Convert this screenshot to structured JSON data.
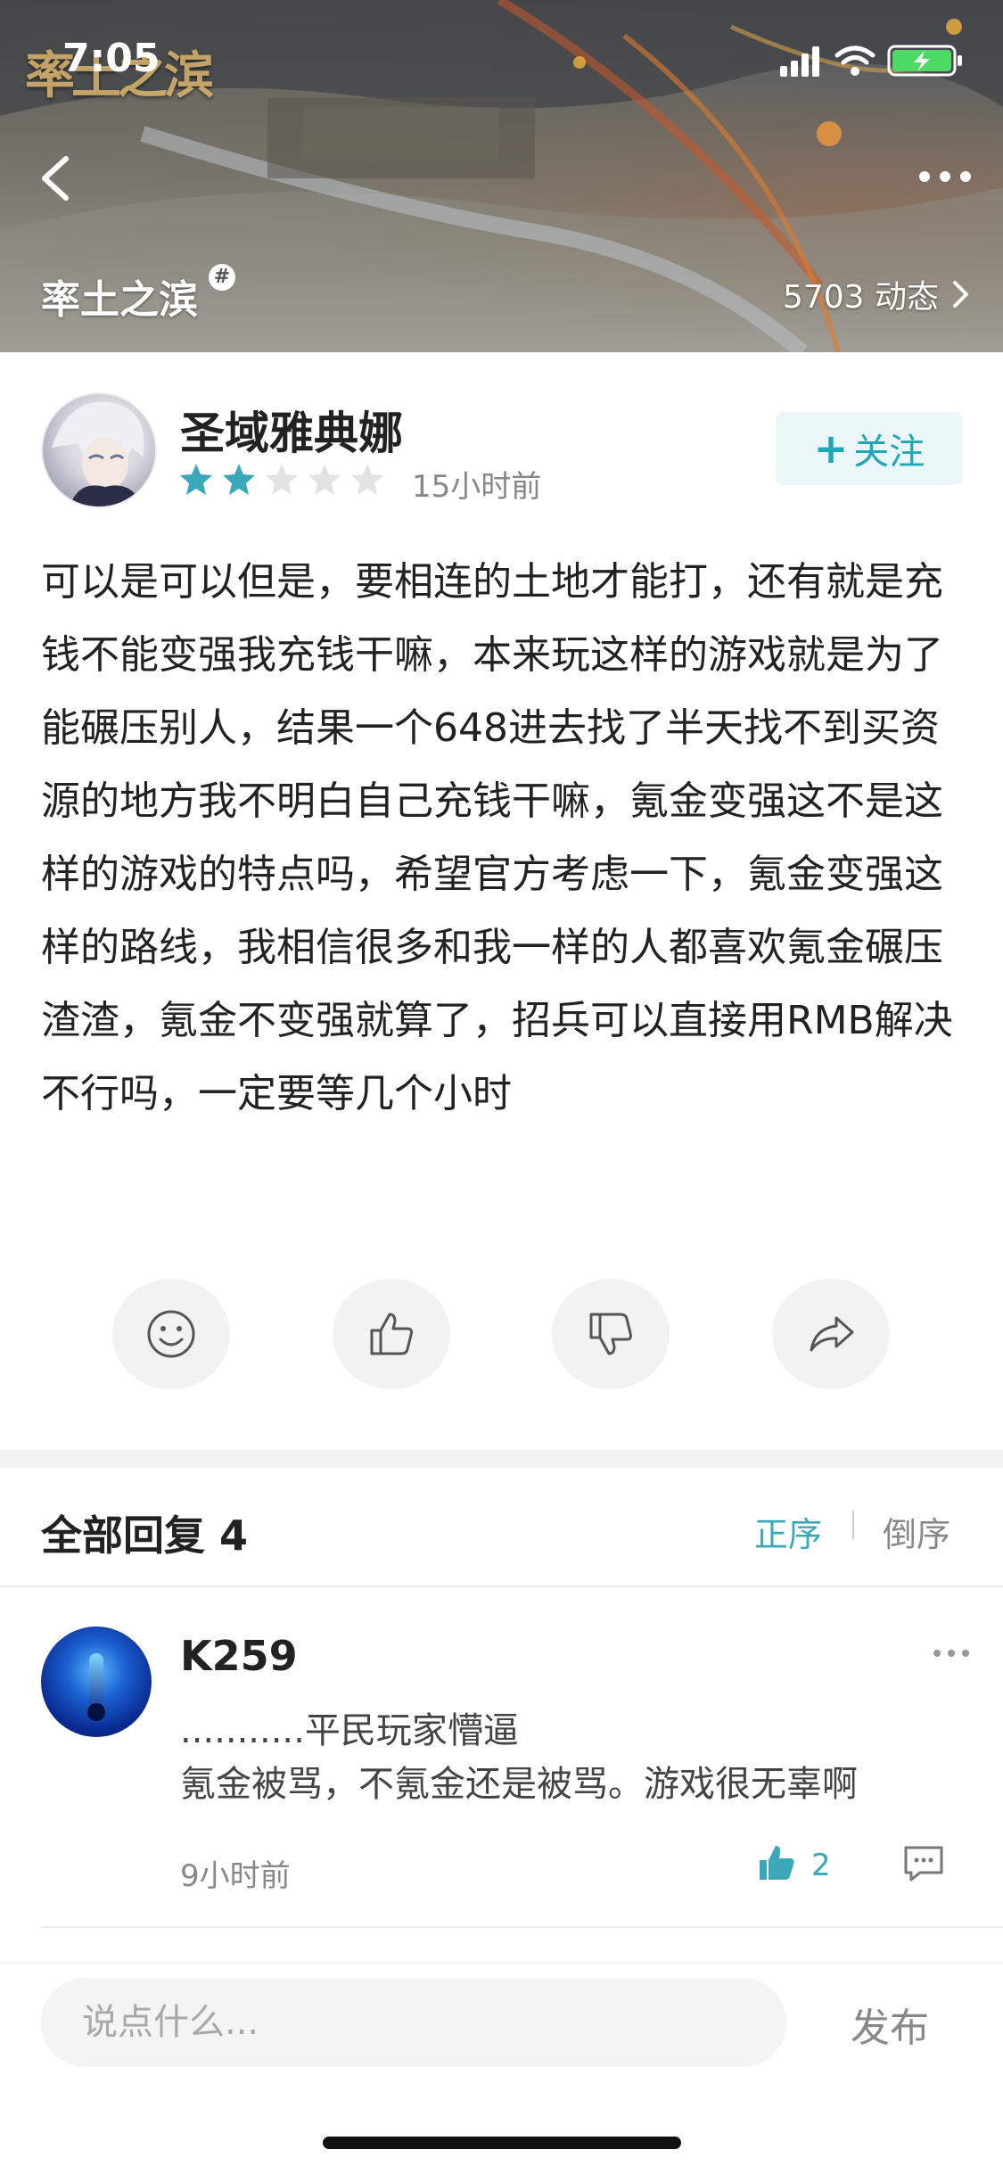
{
  "status_bar": {
    "time": "7:05",
    "icons": [
      "signal-icon",
      "wifi-icon",
      "battery-charging-icon"
    ]
  },
  "header": {
    "logo_text": "率土之滨",
    "game_name": "率土之滨",
    "hash_badge": "#",
    "dynamics_count": "5703 动态"
  },
  "post": {
    "author": "圣域雅典娜",
    "rating": 2,
    "rating_max": 5,
    "time": "15小时前",
    "follow_label": "+关注",
    "follow_plus": "+",
    "follow_text": "关注",
    "body": "可以是可以但是，要相连的土地才能打，还有就是充钱不能变强我充钱干嘛，本来玩这样的游戏就是为了能碾压别人，结果一个648进去找了半天找不到买资源的地方我不明白自己充钱干嘛，氪金变强这不是这样的游戏的特点吗，希望官方考虑一下，氪金变强这样的路线，我相信很多和我一样的人都喜欢氪金碾压渣渣，氪金不变强就算了，招兵可以直接用RMB解决不行吗，一定要等几个小时",
    "actions": [
      "smile-icon",
      "thumbs-up-icon",
      "thumbs-down-icon",
      "share-icon"
    ]
  },
  "replies": {
    "title": "全部回复 4",
    "sort_asc": "正序",
    "sort_desc": "倒序",
    "items": [
      {
        "name": "K259",
        "line1": "...........平民玩家懵逼",
        "line2": "氪金被骂，不氪金还是被骂。游戏很无辜啊",
        "time": "9小时前",
        "likes": "2"
      }
    ]
  },
  "composer": {
    "placeholder": "说点什么...",
    "publish_label": "发布"
  },
  "colors": {
    "accent": "#3aa8b8",
    "star_on": "#3aa8b8",
    "star_off": "#e3e3e3",
    "follow_bg": "#eaf6f8"
  }
}
